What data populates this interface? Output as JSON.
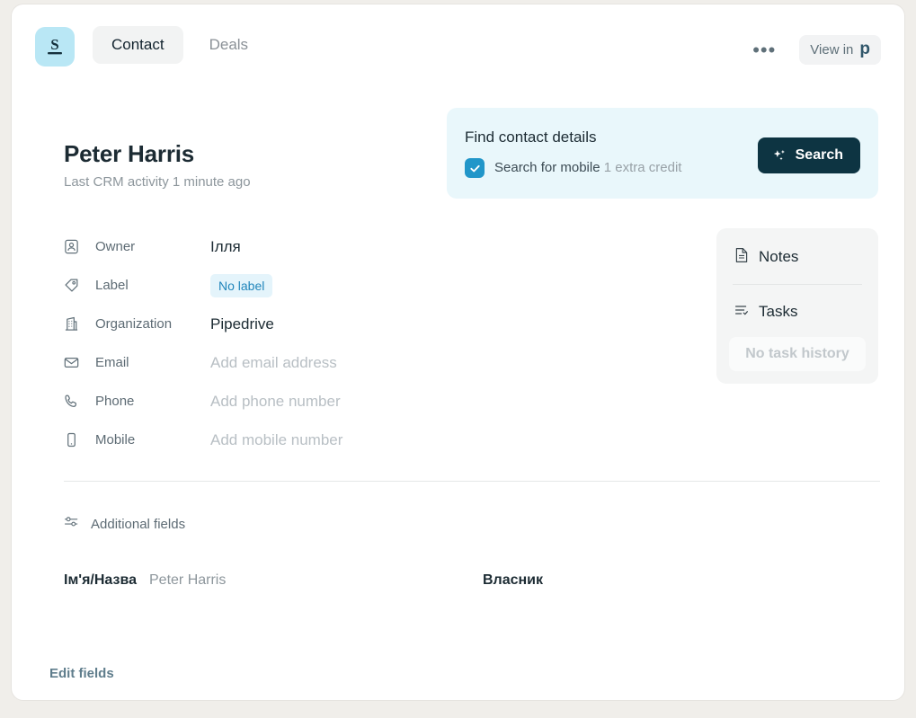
{
  "app": {
    "logo_icon": "surfe-s-logo",
    "brand_color": "#b9e7f5"
  },
  "header": {
    "tabs": [
      {
        "label": "Contact",
        "active": true
      },
      {
        "label": "Deals",
        "active": false
      }
    ],
    "more_button": "•••",
    "view_in": {
      "label": "View in",
      "logo_text": "p",
      "logo_name": "pipedrive-logo"
    }
  },
  "contact": {
    "name": "Peter Harris",
    "subtitle": "Last CRM activity 1 minute ago"
  },
  "find_card": {
    "title": "Find contact details",
    "checkbox_checked": true,
    "option_label": "Search for mobile",
    "credit_note": "1 extra credit",
    "search_button": "Search",
    "background": "#e9f7fb",
    "button_color": "#0d3442",
    "checkbox_color": "#2196c9"
  },
  "fields": [
    {
      "icon": "user-icon",
      "label": "Owner",
      "value": "Ілля",
      "type": "text"
    },
    {
      "icon": "tag-icon",
      "label": "Label",
      "value": "No label",
      "type": "chip"
    },
    {
      "icon": "building-icon",
      "label": "Organization",
      "value": "Pipedrive",
      "type": "text"
    },
    {
      "icon": "envelope-icon",
      "label": "Email",
      "value": "Add email address",
      "type": "placeholder"
    },
    {
      "icon": "phone-icon",
      "label": "Phone",
      "value": "Add phone number",
      "type": "placeholder"
    },
    {
      "icon": "mobile-icon",
      "label": "Mobile",
      "value": "Add mobile number",
      "type": "placeholder"
    }
  ],
  "side_panel": {
    "notes_label": "Notes",
    "notes_icon": "document-icon",
    "tasks_label": "Tasks",
    "tasks_icon": "task-list-icon",
    "no_task_history": "No task history"
  },
  "additional_fields": {
    "label": "Additional fields",
    "icon": "sliders-icon"
  },
  "extra_fields": {
    "name_key": "Ім'я/Назва",
    "name_value": "Peter Harris",
    "owner_key": "Власник"
  },
  "footer": {
    "edit_fields": "Edit fields"
  }
}
